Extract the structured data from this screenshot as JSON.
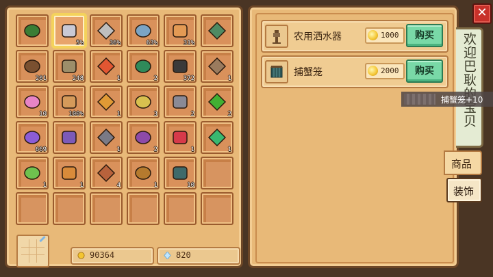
{
  "inventory": {
    "slots": [
      {
        "name": "pickaxe",
        "label": "",
        "color": "#3b7d35"
      },
      {
        "name": "axe",
        "label": "5%",
        "color": "#c9c9d4"
      },
      {
        "name": "scythe",
        "label": "36%",
        "color": "#bfbfbf"
      },
      {
        "name": "watering-can",
        "label": "63%",
        "color": "#7ba4c4"
      },
      {
        "name": "fishing-rod",
        "label": "31%",
        "color": "#e39a54"
      },
      {
        "name": "hoe",
        "label": "",
        "color": "#4f8a63"
      },
      {
        "name": "wood",
        "label": "201",
        "color": "#7a5030"
      },
      {
        "name": "stone",
        "label": "248",
        "color": "#9c8e6a"
      },
      {
        "name": "shrimp",
        "label": "1",
        "color": "#e25632"
      },
      {
        "name": "seaweed",
        "label": "2",
        "color": "#2f8a5a"
      },
      {
        "name": "coal",
        "label": "372",
        "color": "#3a3a3a"
      },
      {
        "name": "net",
        "label": "1",
        "color": "#9a7b5e"
      },
      {
        "name": "crystal",
        "label": "10",
        "color": "#e784c6"
      },
      {
        "name": "bamboo-rod",
        "label": "100%",
        "color": "#d59a5a"
      },
      {
        "name": "feather",
        "label": "1",
        "color": "#e09a35"
      },
      {
        "name": "banana",
        "label": "3",
        "color": "#d8c04f"
      },
      {
        "name": "iron-ore",
        "label": "2",
        "color": "#8a8a96"
      },
      {
        "name": "emerald",
        "label": "2",
        "color": "#41b033"
      },
      {
        "name": "purple-pearl",
        "label": "669",
        "color": "#8b5cd6"
      },
      {
        "name": "purple-sword",
        "label": "",
        "color": "#7c5ab8"
      },
      {
        "name": "stone-bag",
        "label": "1",
        "color": "#7a7a86"
      },
      {
        "name": "purple-bag",
        "label": "2",
        "color": "#8d4aa8"
      },
      {
        "name": "red-potion",
        "label": "1",
        "color": "#d63a4a"
      },
      {
        "name": "green-potion",
        "label": "1",
        "color": "#3ab870"
      },
      {
        "name": "caterpillar",
        "label": "1",
        "color": "#6fc14e"
      },
      {
        "name": "lantern",
        "label": "1",
        "color": "#d98b3a"
      },
      {
        "name": "log",
        "label": "4",
        "color": "#b8623c"
      },
      {
        "name": "acorn",
        "label": "1",
        "color": "#b57a2e"
      },
      {
        "name": "crab-cage",
        "label": "10",
        "color": "#3f6a6a"
      },
      {
        "name": "empty",
        "label": "",
        "color": ""
      },
      {
        "name": "empty",
        "label": "",
        "color": ""
      },
      {
        "name": "empty",
        "label": "",
        "color": ""
      },
      {
        "name": "empty",
        "label": "",
        "color": ""
      },
      {
        "name": "empty",
        "label": "",
        "color": ""
      },
      {
        "name": "empty",
        "label": "",
        "color": ""
      },
      {
        "name": "empty",
        "label": "",
        "color": ""
      }
    ],
    "selected_index": 1
  },
  "wallet": {
    "gold": "90364",
    "gems": "820"
  },
  "shop": {
    "items": [
      {
        "name": "农用洒水器",
        "price": "1000",
        "buy_label": "购买"
      },
      {
        "name": "捕蟹笼",
        "price": "2000",
        "buy_label": "购买"
      }
    ]
  },
  "tabs": {
    "banner": "欢迎巴耿的宝贝",
    "goods": "商品",
    "decoration": "装饰"
  },
  "close_label": "✕",
  "tooltip": "捕蟹笼+10",
  "colors": {
    "buy_button": "#79d9a7",
    "close_button": "#c8312a",
    "panel": "#e8b978"
  }
}
